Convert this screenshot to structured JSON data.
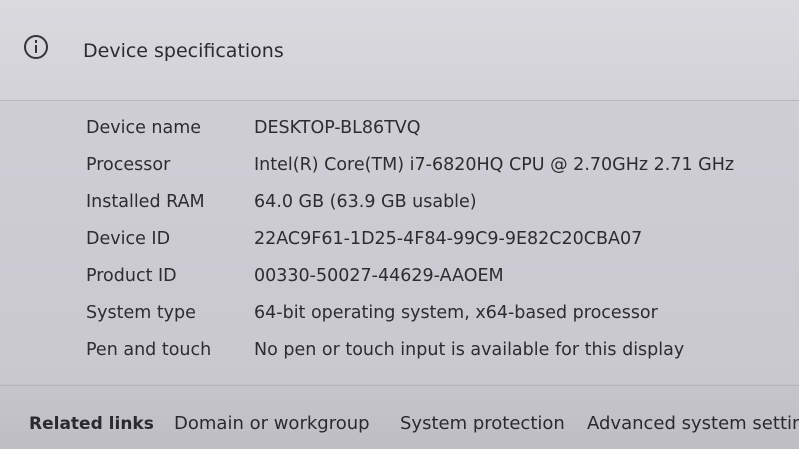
{
  "header": {
    "title": "Device specifications",
    "icon": "info-icon"
  },
  "specs": [
    {
      "label": "Device name",
      "value": "DESKTOP-BL86TVQ"
    },
    {
      "label": "Processor",
      "value": "Intel(R) Core(TM) i7-6820HQ CPU @ 2.70GHz   2.71 GHz"
    },
    {
      "label": "Installed RAM",
      "value": "64.0 GB (63.9 GB usable)"
    },
    {
      "label": "Device ID",
      "value": "22AC9F61-1D25-4F84-99C9-9E82C20CBA07"
    },
    {
      "label": "Product ID",
      "value": "00330-50027-44629-AAOEM"
    },
    {
      "label": "System type",
      "value": "64-bit operating system, x64-based processor"
    },
    {
      "label": "Pen and touch",
      "value": "No pen or touch input is available for this display"
    }
  ],
  "related": {
    "title": "Related links",
    "links": [
      "Domain or workgroup",
      "System protection",
      "Advanced system settings"
    ]
  }
}
